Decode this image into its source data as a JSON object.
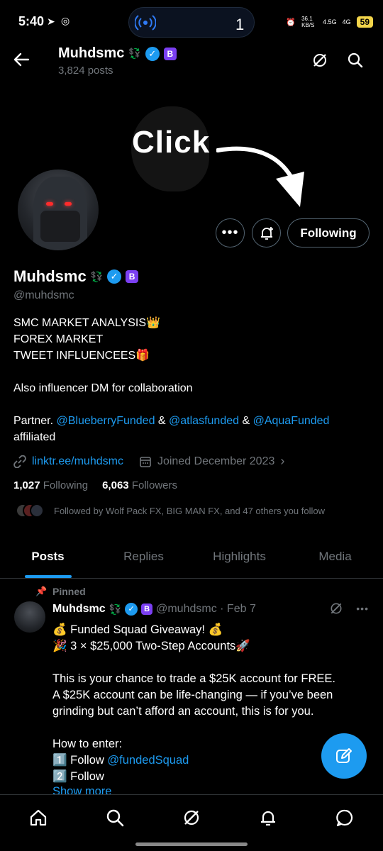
{
  "status_bar": {
    "time": "5:40",
    "pill_count": "1",
    "net_speed": "36.1 KB/S",
    "signal1": "4.5G",
    "signal2": "4G",
    "battery": "59"
  },
  "header": {
    "name": "Muhdsmc",
    "symbols": "💱",
    "badge": "B",
    "post_count": "3,824 posts"
  },
  "overlay": {
    "text": "Click"
  },
  "profile": {
    "follow_button": "Following",
    "name": "Muhdsmc",
    "symbols": "💱",
    "badge": "B",
    "handle": "@muhdsmc",
    "bio_line1": "SMC MARKET ANALYSIS👑",
    "bio_line2": "FOREX MARKET",
    "bio_line3": "TWEET INFLUENCEES🎁",
    "bio_line4": "Also influencer DM for collaboration",
    "partner_prefix": "Partner. ",
    "partner1": "@BlueberryFunded",
    "amp": " & ",
    "partner2": "@atlasfunded",
    "partner3": "@AquaFunded",
    "partner_suffix": "affiliated",
    "link": "linktr.ee/muhdsmc",
    "joined": "Joined December 2023",
    "following_count": "1,027",
    "following_label": "Following",
    "followers_count": "6,063",
    "followers_label": "Followers",
    "followed_by": "Followed by Wolf Pack FX, BIG MAN FX, and 47 others you follow"
  },
  "tabs": [
    "Posts",
    "Replies",
    "Highlights",
    "Media"
  ],
  "tweet": {
    "pinned": "Pinned",
    "name": "Muhdsmc",
    "symbols": "💱",
    "badge": "B",
    "handle_date": "@muhdsmc · Feb 7",
    "line1": "💰 Funded Squad Giveaway! 💰",
    "line2": "🎉 3 × $25,000 Two-Step Accounts🚀",
    "line3": "This is your chance to trade a $25K account for FREE.",
    "line4": "A $25K account can be life-changing — if you’ve been grinding but can’t afford an account, this is for you.",
    "line5": "How to enter:",
    "line6_prefix": "1️⃣ Follow ",
    "line6_link": "@fundedSquad",
    "line7": "2️⃣ Follow",
    "show_more": "Show more"
  },
  "colors": {
    "accent": "#1d9bf0",
    "background": "#000000",
    "muted": "#71767b"
  }
}
